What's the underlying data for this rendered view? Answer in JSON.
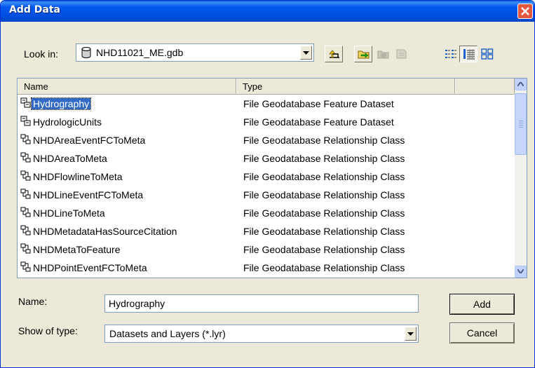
{
  "window": {
    "title": "Add Data"
  },
  "lookin": {
    "label": "Look in:",
    "value": "NHD11021_ME.gdb"
  },
  "toolbar": {
    "icons": [
      "up-one-level-icon",
      "connect-to-folder-icon",
      "disconnect-folder-icon",
      "new-folder-icon",
      "list-view-icon",
      "details-view-icon",
      "thumbnails-view-icon"
    ],
    "active_view": "details"
  },
  "list": {
    "columns": [
      "Name",
      "Type"
    ],
    "rows": [
      {
        "name": "Hydrography",
        "type": "File Geodatabase Feature Dataset",
        "icon": "feature-dataset-icon",
        "selected": true
      },
      {
        "name": "HydrologicUnits",
        "type": "File Geodatabase Feature Dataset",
        "icon": "feature-dataset-icon"
      },
      {
        "name": "NHDAreaEventFCToMeta",
        "type": "File Geodatabase Relationship Class",
        "icon": "relationship-class-icon"
      },
      {
        "name": "NHDAreaToMeta",
        "type": "File Geodatabase Relationship Class",
        "icon": "relationship-class-icon"
      },
      {
        "name": "NHDFlowlineToMeta",
        "type": "File Geodatabase Relationship Class",
        "icon": "relationship-class-icon"
      },
      {
        "name": "NHDLineEventFCToMeta",
        "type": "File Geodatabase Relationship Class",
        "icon": "relationship-class-icon"
      },
      {
        "name": "NHDLineToMeta",
        "type": "File Geodatabase Relationship Class",
        "icon": "relationship-class-icon"
      },
      {
        "name": "NHDMetadataHasSourceCitation",
        "type": "File Geodatabase Relationship Class",
        "icon": "relationship-class-icon"
      },
      {
        "name": "NHDMetaToFeature",
        "type": "File Geodatabase Relationship Class",
        "icon": "relationship-class-icon"
      },
      {
        "name": "NHDPointEventFCToMeta",
        "type": "File Geodatabase Relationship Class",
        "icon": "relationship-class-icon"
      }
    ]
  },
  "form": {
    "name_label": "Name:",
    "name_value": "Hydrography",
    "type_label": "Show of type:",
    "type_value": "Datasets and Layers (*.lyr)"
  },
  "buttons": {
    "add": "Add",
    "cancel": "Cancel"
  },
  "colors": {
    "titlebar": "#0058ee",
    "selection": "#316ac5",
    "window_bg": "#ece9d8",
    "close": "#e2583e"
  }
}
